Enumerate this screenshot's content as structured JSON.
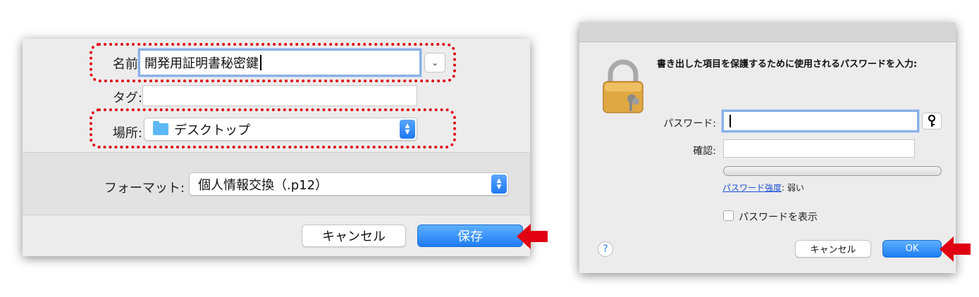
{
  "save_dialog": {
    "name_label": "名前:",
    "name_value": "開発用証明書秘密鍵",
    "tags_label": "タグ:",
    "tags_value": "",
    "where_label": "場所:",
    "where_value": "デスクトップ",
    "format_label": "フォーマット:",
    "format_value": "個人情報交換（.p12）",
    "cancel_label": "キャンセル",
    "save_label": "保存"
  },
  "password_dialog": {
    "prompt": "書き出した項目を保護するために使用されるパスワードを入力:",
    "password_label": "パスワード:",
    "password_value": "",
    "verify_label": "確認:",
    "verify_value": "",
    "strength_link": "パスワード強度",
    "strength_value": ": 弱い",
    "strength_level": 0,
    "show_password_label": "パスワードを表示",
    "show_password_checked": false,
    "help_label": "?",
    "cancel_label": "キャンセル",
    "ok_label": "OK"
  },
  "colors": {
    "highlight_border": "#e00012",
    "arrow": "#e00012",
    "accent_blue": "#1f7cf4"
  },
  "icons": [
    "folder-icon",
    "chevron-down-icon",
    "stepper-icon",
    "lock-icon",
    "key-icon",
    "help-icon",
    "arrow-left-icon"
  ]
}
